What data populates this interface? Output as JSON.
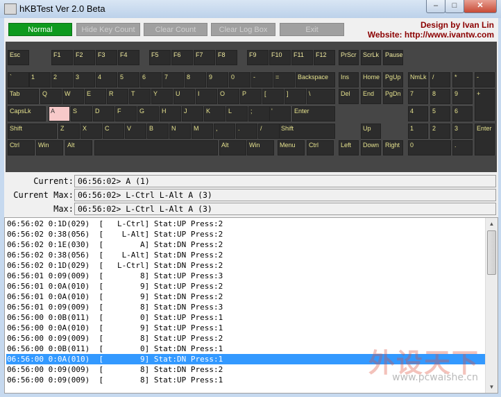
{
  "window": {
    "title": "hKBTest Ver 2.0 Beta",
    "controls": {
      "minimize": "–",
      "maximize": "□",
      "close": "✕"
    }
  },
  "toolbar": {
    "normal_label": "Normal",
    "hide_key_count_label": "Hide Key Count",
    "clear_count_label": "Clear Count",
    "clear_log_box_label": "Clear Log Box",
    "exit_label": "Exit"
  },
  "credits": {
    "design": "Design by Ivan Lin",
    "website": "Website: http://www.ivantw.com"
  },
  "keyboard": {
    "keys": [
      {
        "id": "esc",
        "label": "Esc"
      },
      {
        "id": "f1",
        "label": "F1"
      },
      {
        "id": "f2",
        "label": "F2"
      },
      {
        "id": "f3",
        "label": "F3"
      },
      {
        "id": "f4",
        "label": "F4"
      },
      {
        "id": "f5",
        "label": "F5"
      },
      {
        "id": "f6",
        "label": "F6"
      },
      {
        "id": "f7",
        "label": "F7"
      },
      {
        "id": "f8",
        "label": "F8"
      },
      {
        "id": "f9",
        "label": "F9"
      },
      {
        "id": "f10",
        "label": "F10"
      },
      {
        "id": "f11",
        "label": "F11"
      },
      {
        "id": "f12",
        "label": "F12"
      },
      {
        "id": "prscr",
        "label": "PrScr"
      },
      {
        "id": "scrlk",
        "label": "ScrLk"
      },
      {
        "id": "pause",
        "label": "Pause"
      },
      {
        "id": "grave",
        "label": "`"
      },
      {
        "id": "k1",
        "label": "1"
      },
      {
        "id": "k2",
        "label": "2"
      },
      {
        "id": "k3",
        "label": "3"
      },
      {
        "id": "k4",
        "label": "4"
      },
      {
        "id": "k5",
        "label": "5"
      },
      {
        "id": "k6",
        "label": "6"
      },
      {
        "id": "k7",
        "label": "7"
      },
      {
        "id": "k8",
        "label": "8"
      },
      {
        "id": "k9",
        "label": "9"
      },
      {
        "id": "k0",
        "label": "0"
      },
      {
        "id": "minus",
        "label": "-"
      },
      {
        "id": "equals",
        "label": "="
      },
      {
        "id": "backspace",
        "label": "Backspace"
      },
      {
        "id": "ins",
        "label": "Ins"
      },
      {
        "id": "home",
        "label": "Home"
      },
      {
        "id": "pgup",
        "label": "PgUp"
      },
      {
        "id": "numlk",
        "label": "NmLk"
      },
      {
        "id": "npdiv",
        "label": "/"
      },
      {
        "id": "npmul",
        "label": "*"
      },
      {
        "id": "npsub",
        "label": "-"
      },
      {
        "id": "tab",
        "label": "Tab"
      },
      {
        "id": "q",
        "label": "Q"
      },
      {
        "id": "w",
        "label": "W"
      },
      {
        "id": "e",
        "label": "E"
      },
      {
        "id": "r",
        "label": "R"
      },
      {
        "id": "t",
        "label": "T"
      },
      {
        "id": "y",
        "label": "Y"
      },
      {
        "id": "u",
        "label": "U"
      },
      {
        "id": "i",
        "label": "I"
      },
      {
        "id": "o",
        "label": "O"
      },
      {
        "id": "p",
        "label": "P"
      },
      {
        "id": "lbr",
        "label": "["
      },
      {
        "id": "rbr",
        "label": "]"
      },
      {
        "id": "bslash",
        "label": "\\"
      },
      {
        "id": "del",
        "label": "Del"
      },
      {
        "id": "end",
        "label": "End"
      },
      {
        "id": "pgdn",
        "label": "PgDn"
      },
      {
        "id": "np7",
        "label": "7"
      },
      {
        "id": "np8",
        "label": "8"
      },
      {
        "id": "np9",
        "label": "9"
      },
      {
        "id": "npadd",
        "label": "+"
      },
      {
        "id": "capslk",
        "label": "CapsLk"
      },
      {
        "id": "a",
        "label": "A"
      },
      {
        "id": "s",
        "label": "S"
      },
      {
        "id": "d",
        "label": "D"
      },
      {
        "id": "f",
        "label": "F"
      },
      {
        "id": "g",
        "label": "G"
      },
      {
        "id": "h",
        "label": "H"
      },
      {
        "id": "j",
        "label": "J"
      },
      {
        "id": "k",
        "label": "K"
      },
      {
        "id": "l",
        "label": "L"
      },
      {
        "id": "semi",
        "label": ";"
      },
      {
        "id": "quote",
        "label": "'"
      },
      {
        "id": "enter",
        "label": "Enter"
      },
      {
        "id": "np4",
        "label": "4"
      },
      {
        "id": "np5",
        "label": "5"
      },
      {
        "id": "np6",
        "label": "6"
      },
      {
        "id": "lshift",
        "label": "Shift"
      },
      {
        "id": "z",
        "label": "Z"
      },
      {
        "id": "x",
        "label": "X"
      },
      {
        "id": "c",
        "label": "C"
      },
      {
        "id": "v",
        "label": "V"
      },
      {
        "id": "b",
        "label": "B"
      },
      {
        "id": "n",
        "label": "N"
      },
      {
        "id": "m",
        "label": "M"
      },
      {
        "id": "comma",
        "label": ","
      },
      {
        "id": "period",
        "label": "."
      },
      {
        "id": "slash",
        "label": "/"
      },
      {
        "id": "rshift",
        "label": "Shift"
      },
      {
        "id": "up",
        "label": "Up"
      },
      {
        "id": "np1",
        "label": "1"
      },
      {
        "id": "np2",
        "label": "2"
      },
      {
        "id": "np3",
        "label": "3"
      },
      {
        "id": "npenter",
        "label": "Enter"
      },
      {
        "id": "lctrl",
        "label": "Ctrl"
      },
      {
        "id": "lwin",
        "label": "Win"
      },
      {
        "id": "lalt",
        "label": "Alt"
      },
      {
        "id": "space",
        "label": ""
      },
      {
        "id": "ralt",
        "label": "Alt"
      },
      {
        "id": "rwin",
        "label": "Win"
      },
      {
        "id": "menu",
        "label": "Menu"
      },
      {
        "id": "rctrl",
        "label": "Ctrl"
      },
      {
        "id": "left",
        "label": "Left"
      },
      {
        "id": "down",
        "label": "Down"
      },
      {
        "id": "right",
        "label": "Right"
      },
      {
        "id": "np0",
        "label": "0"
      },
      {
        "id": "npdot",
        "label": "."
      }
    ],
    "pressed_key": "a"
  },
  "status": {
    "current_label": "Current:",
    "current_value": "06:56:02> A (1)",
    "current_max_label": "Current Max:",
    "current_max_value": "06:56:02> L-Ctrl L-Alt A (3)",
    "max_label": "Max:",
    "max_value": "06:56:02> L-Ctrl L-Alt A (3)"
  },
  "log": {
    "lines": [
      "06:56:02 0:1D(029)  [   L-Ctrl] Stat:UP Press:2",
      "06:56:02 0:38(056)  [    L-Alt] Stat:UP Press:2",
      "06:56:02 0:1E(030)  [        A] Stat:DN Press:2",
      "06:56:02 0:38(056)  [    L-Alt] Stat:DN Press:2",
      "06:56:02 0:1D(029)  [   L-Ctrl] Stat:DN Press:2",
      "06:56:01 0:09(009)  [        8] Stat:UP Press:3",
      "06:56:01 0:0A(010)  [        9] Stat:UP Press:2",
      "06:56:01 0:0A(010)  [        9] Stat:DN Press:2",
      "06:56:01 0:09(009)  [        8] Stat:DN Press:3",
      "06:56:00 0:0B(011)  [        0] Stat:UP Press:1",
      "06:56:00 0:0A(010)  [        9] Stat:UP Press:1",
      "06:56:00 0:09(009)  [        8] Stat:UP Press:2",
      "06:56:00 0:0B(011)  [        0] Stat:DN Press:1",
      "06:56:00 0:0A(010)  [        9] Stat:DN Press:1",
      "06:56:00 0:09(009)  [        8] Stat:DN Press:2",
      "06:56:00 0:09(009)  [        8] Stat:UP Press:1"
    ],
    "selected_index": 13
  },
  "watermark": {
    "text_cn": "外设天下",
    "text_url": "www.pcwaishe.cn"
  },
  "colors": {
    "normal_button": "#0e9a1e",
    "credit_text": "#8b0000",
    "keyboard_bg": "#464646",
    "key_bg": "#2c2c2c",
    "key_label": "#e6e28e",
    "pressed_key": "#f7c9c9",
    "selection": "#3399ff"
  }
}
